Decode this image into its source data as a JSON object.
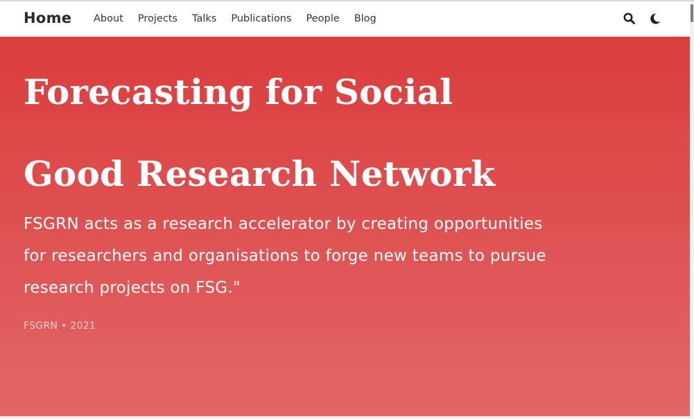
{
  "navbar": {
    "brand": "Home",
    "links": [
      "About",
      "Projects",
      "Talks",
      "Publications",
      "People",
      "Blog"
    ],
    "icons": [
      "search-icon",
      "moon-icon"
    ]
  },
  "hero": {
    "title": "Forecasting for Social Good Research Network",
    "description": "FSGRN acts as a research accelerator by creating opportunities for researchers and organisations to forge new teams to pursue research projects on FSG.\"",
    "meta": "FSGRN • 2021"
  },
  "colors": {
    "hero_top": "#db3d3d",
    "hero_bottom": "#e26666",
    "nav_text": "#333333"
  }
}
